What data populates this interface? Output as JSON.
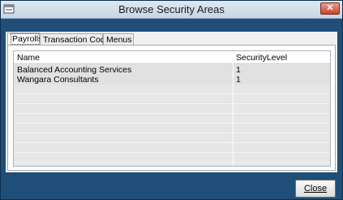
{
  "window": {
    "title": "Browse Security Areas",
    "close_glyph": "✕"
  },
  "tabs": [
    {
      "label": "Payrolls",
      "active": true
    },
    {
      "label": "Transaction Codes",
      "active": false
    },
    {
      "label": "Menus",
      "active": false
    }
  ],
  "grid": {
    "columns": [
      "Name",
      "SecurityLevel"
    ],
    "rows": [
      {
        "name": "Balanced Accounting Services",
        "level": "1"
      },
      {
        "name": "Wangara Consultants",
        "level": "1"
      }
    ]
  },
  "footer": {
    "close_label": "Close"
  },
  "colors": {
    "frame": "#1f4e79",
    "titlebar": "#dfe8f1",
    "close_button_red": "#c7432a"
  },
  "icons": {
    "app": "app-window-icon",
    "close": "close-icon"
  }
}
